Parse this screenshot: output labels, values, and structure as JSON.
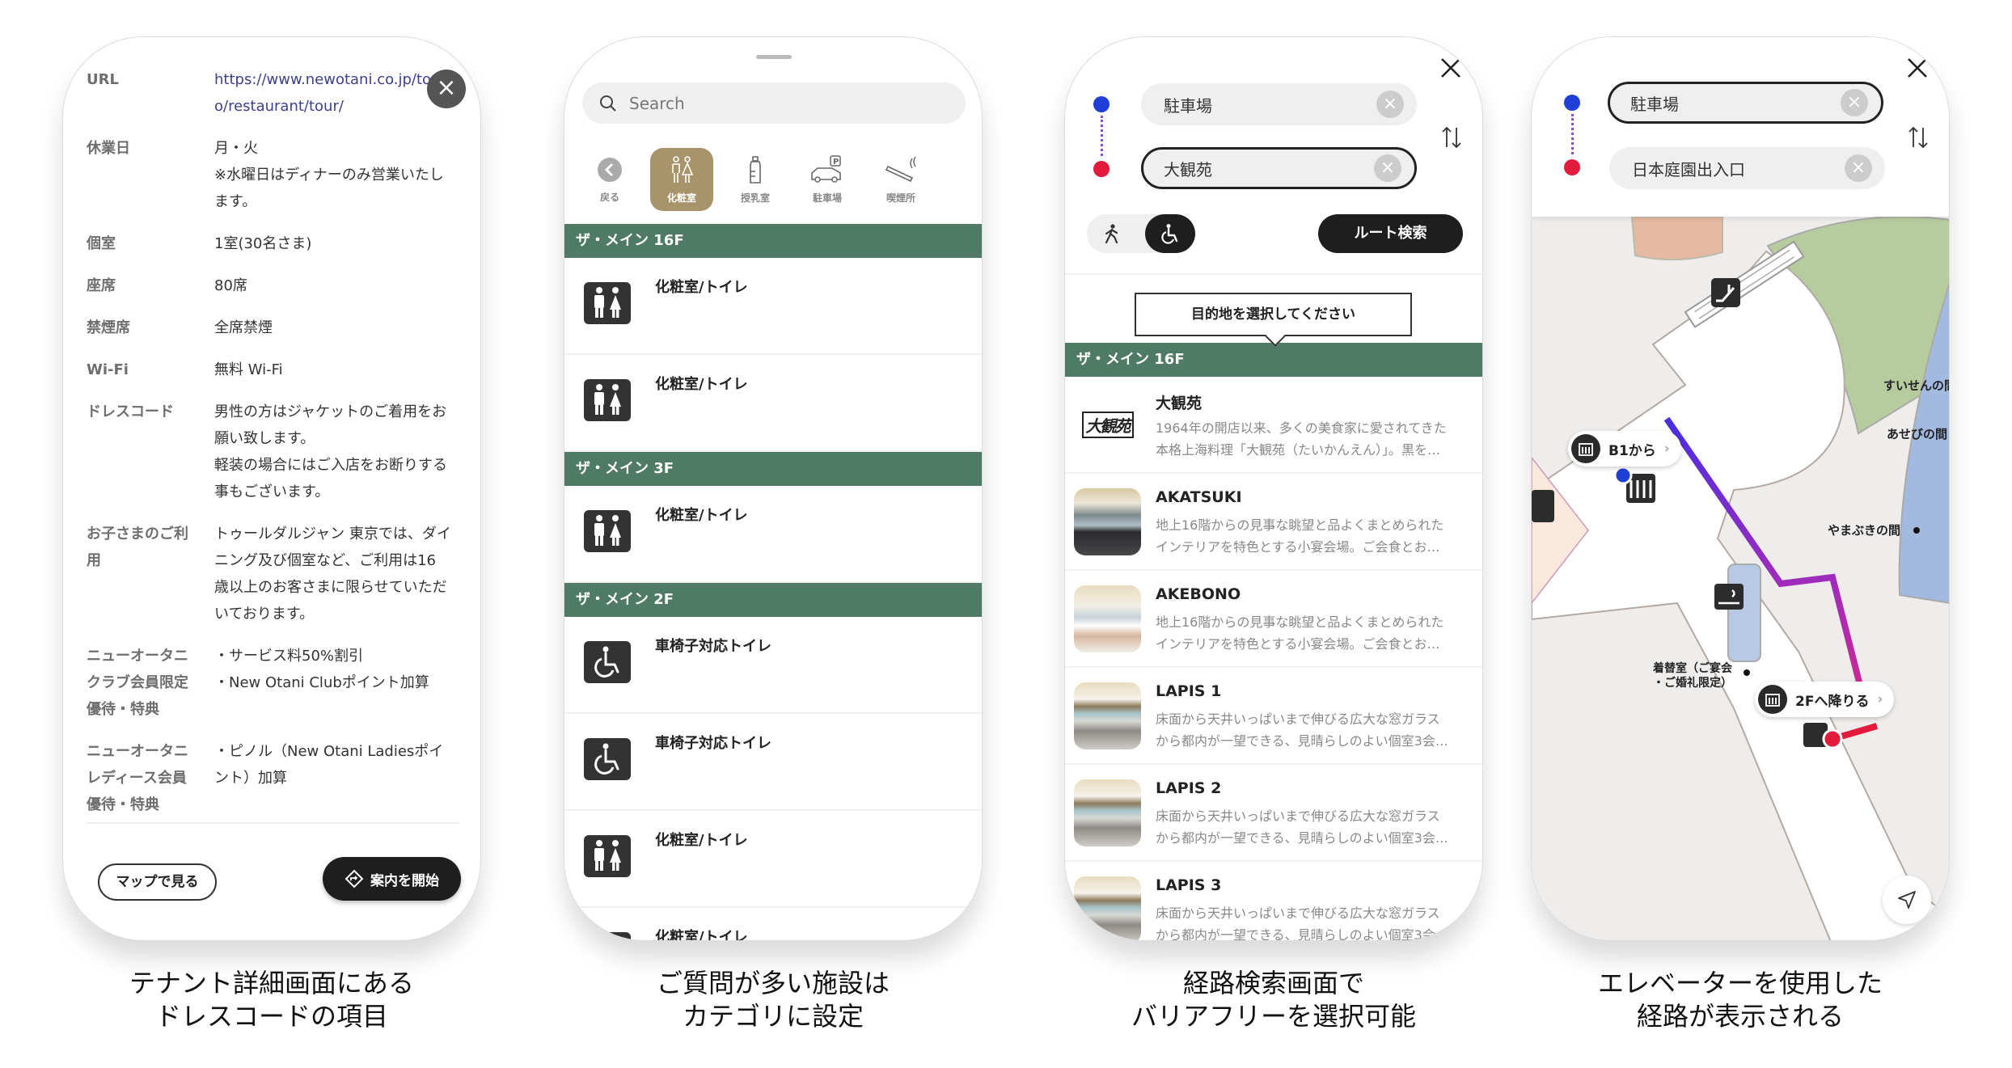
{
  "colors": {
    "section_header": "#4f7a66",
    "category_selected": "#a8946b",
    "origin_dot": "#1f3fd6",
    "destination_dot": "#e21a3c",
    "route_start": "#4a2ee0",
    "route_mid": "#a62bb8",
    "route_end": "#e21a3c",
    "dark_button": "#1e1e1e"
  },
  "tenant_detail": {
    "close_icon": "close-icon",
    "rows": [
      {
        "label": [
          "URL"
        ],
        "value": [
          "https://www.newotani.co.jp/to",
          "o/restaurant/tour/"
        ],
        "link": true
      },
      {
        "label": [
          "休業日"
        ],
        "value": [
          "月・火",
          "※水曜日はディナーのみ営業いたし",
          "ます。"
        ]
      },
      {
        "label": [
          "個室"
        ],
        "value": [
          "1室(30名さま)"
        ]
      },
      {
        "label": [
          "座席"
        ],
        "value": [
          "80席"
        ]
      },
      {
        "label": [
          "禁煙席"
        ],
        "value": [
          "全席禁煙"
        ]
      },
      {
        "label": [
          "Wi-Fi"
        ],
        "value": [
          "無料 Wi-Fi"
        ]
      },
      {
        "label": [
          "ドレスコード"
        ],
        "value": [
          "男性の方はジャケットのご着用をお",
          "願い致します。",
          "軽装の場合にはご入店をお断りする",
          "事もございます。"
        ]
      },
      {
        "label": [
          "お子さまのご利",
          "用"
        ],
        "value": [
          "トゥールダルジャン 東京では、ダイ",
          "ニング及び個室など、ご利用は16",
          "歳以上のお客さまに限らせていただ",
          "いております。"
        ]
      },
      {
        "label": [
          "ニューオータニ",
          "クラブ会員限定",
          "優待・特典"
        ],
        "value": [
          "・サービス料50%割引",
          "・New Otani Clubポイント加算"
        ]
      },
      {
        "label": [
          "ニューオータニ",
          "レディース会員",
          "優待・特典"
        ],
        "value": [
          "・ピノル（New Otani Ladiesポイ",
          "ント）加算"
        ]
      }
    ],
    "map_button": "マップで見る",
    "start_button": "案内を開始"
  },
  "facility_list": {
    "search_placeholder": "Search",
    "categories": [
      {
        "label": "戻る",
        "icon": "back-icon"
      },
      {
        "label": "化粧室",
        "icon": "restroom-icon",
        "selected": true
      },
      {
        "label": "授乳室",
        "icon": "baby-bottle-icon"
      },
      {
        "label": "駐車場",
        "icon": "parking-icon"
      },
      {
        "label": "喫煙所",
        "icon": "smoking-icon"
      }
    ],
    "groups": [
      {
        "header": "ザ・メイン 16F",
        "items": [
          {
            "title": "化粧室/トイレ",
            "icon": "restroom-icon"
          },
          {
            "title": "化粧室/トイレ",
            "icon": "restroom-icon"
          }
        ]
      },
      {
        "header": "ザ・メイン 3F",
        "items": [
          {
            "title": "化粧室/トイレ",
            "icon": "restroom-icon"
          }
        ]
      },
      {
        "header": "ザ・メイン 2F",
        "items": [
          {
            "title": "車椅子対応トイレ",
            "icon": "wheelchair-icon"
          },
          {
            "title": "車椅子対応トイレ",
            "icon": "wheelchair-icon"
          },
          {
            "title": "化粧室/トイレ",
            "icon": "restroom-icon"
          },
          {
            "title": "化粧室/トイレ",
            "icon": "restroom-icon"
          }
        ]
      }
    ]
  },
  "route_search": {
    "origin": "駐車場",
    "destination": "大観苑",
    "modes": [
      {
        "icon": "walk-icon",
        "selected": false
      },
      {
        "icon": "wheelchair-icon",
        "selected": true
      }
    ],
    "route_button": "ルート検索",
    "tooltip": "目的地を選択してください",
    "section_header": "ザ・メイン 16F",
    "venues": [
      {
        "title": "大観苑",
        "desc": [
          "1964年の開店以来、多くの美食家に愛されてきた",
          "本格上海料理「大観苑（たいかんえん）」。黒を…"
        ],
        "thumb": "logo",
        "logo_text": "大観苑"
      },
      {
        "title": "AKATSUKI",
        "desc": [
          "地上16階からの見事な眺望と品よくまとめられた",
          "インテリアを特色とする小宴会場。ご会食とお…"
        ],
        "thumb": "dark"
      },
      {
        "title": "AKEBONO",
        "desc": [
          "地上16階からの見事な眺望と品よくまとめられた",
          "インテリアを特色とする小宴会場。ご会食とお…"
        ],
        "thumb": "light"
      },
      {
        "title": "LAPIS 1",
        "desc": [
          "床面から天井いっぱいまで伸びる広大な窓ガラス",
          "から都内が一望できる、見晴らしのよい個室3会…"
        ],
        "thumb": "room"
      },
      {
        "title": "LAPIS 2",
        "desc": [
          "床面から天井いっぱいまで伸びる広大な窓ガラス",
          "から都内が一望できる、見晴らしのよい個室3会…"
        ],
        "thumb": "room"
      },
      {
        "title": "LAPIS 3",
        "desc": [
          "床面から天井いっぱいまで伸びる広大な窓ガラス",
          "から都内が一望できる、見晴らしのよい個室3会…"
        ],
        "thumb": "room"
      }
    ]
  },
  "route_map": {
    "origin": "駐車場",
    "destination": "日本庭園出入口",
    "labels": {
      "suisen": "すいせんの間",
      "asebi": "あせびの間",
      "yamabuki": "やまぶきの間",
      "kigae_1": "着替室（ご宴会",
      "kigae_2": "・ご婚礼限定）"
    },
    "from_floor": "B1から",
    "to_floor": "2Fへ降りる"
  },
  "captions": [
    [
      "テナント詳細画面にある",
      "ドレスコードの項目"
    ],
    [
      "ご質問が多い施設は",
      "カテゴリに設定"
    ],
    [
      "経路検索画面で",
      "バリアフリーを選択可能"
    ],
    [
      "エレベーターを使用した",
      "経路が表示される"
    ]
  ]
}
